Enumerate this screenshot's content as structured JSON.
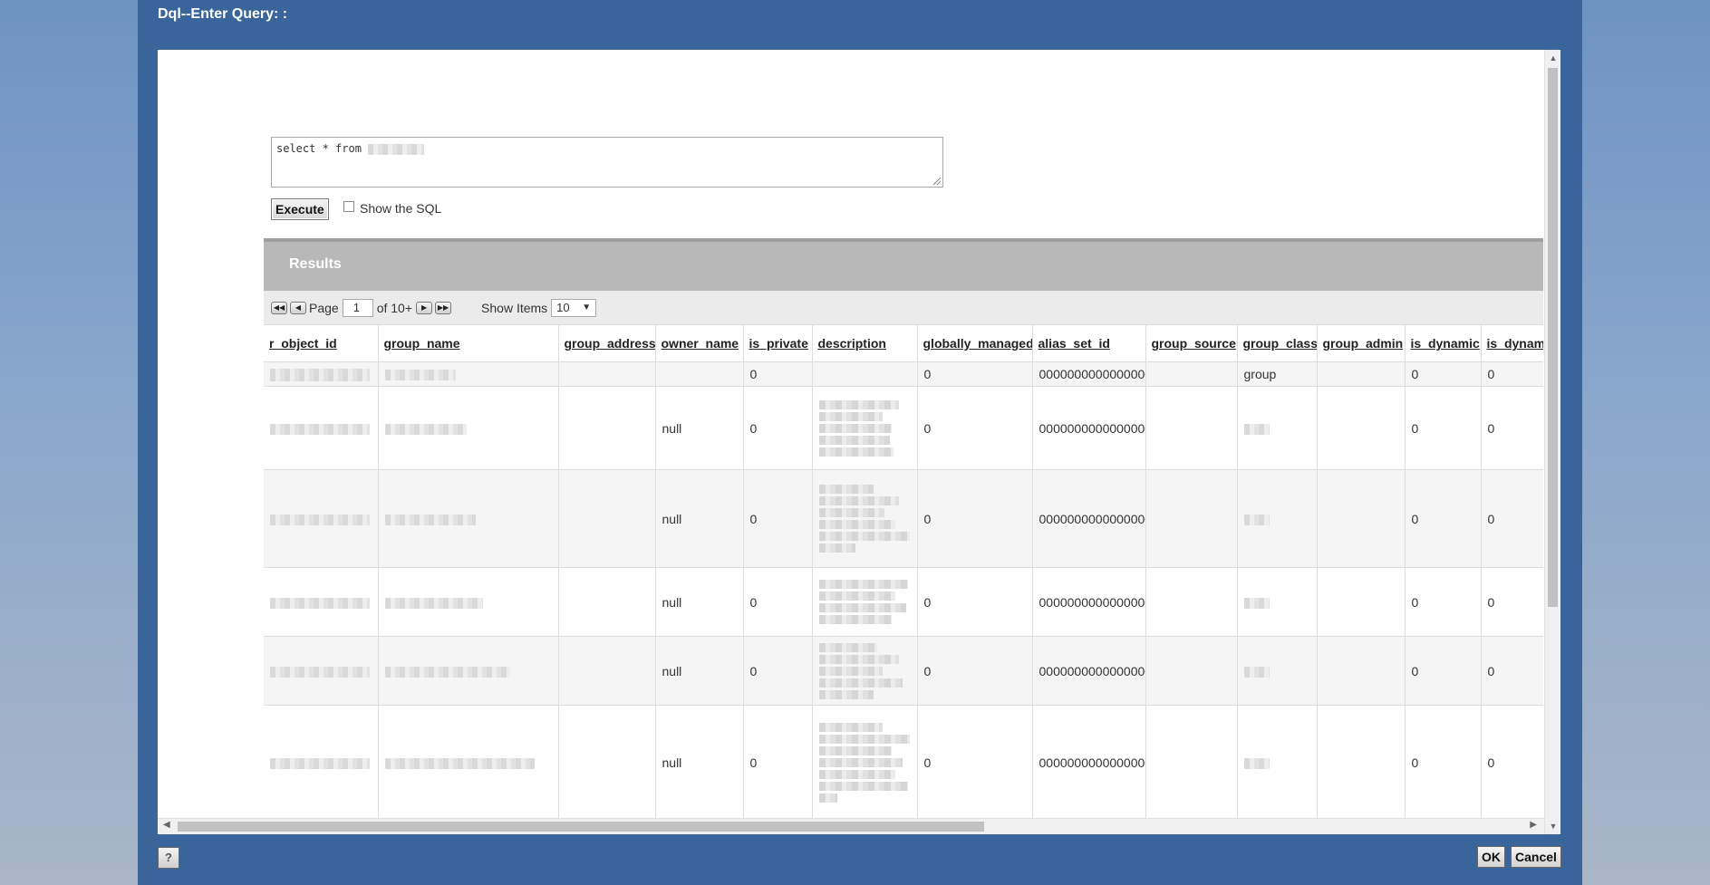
{
  "dialog": {
    "title": "Dql--Enter Query: :"
  },
  "query": {
    "text_prefix": "select * from"
  },
  "execute_label": "Execute",
  "show_sql_label": "Show the SQL",
  "results": {
    "title": "Results",
    "pager": {
      "page_label": "Page",
      "page_value": "1",
      "of_label": "of 10+",
      "show_items_label": "Show Items",
      "show_items_value": "10"
    },
    "columns": [
      "r_object_id",
      "group_name",
      "group_address",
      "owner_name",
      "is_private",
      "description",
      "globally_managed",
      "alias_set_id",
      "group_source",
      "group_class",
      "group_admin",
      "is_dynamic",
      "is_dynam"
    ],
    "rows": [
      {
        "owner_name": "",
        "is_private": "0",
        "globally_managed": "0",
        "alias_set_id": "0000000000000000",
        "group_class": "group",
        "is_dynamic": "0",
        "is_dynam": "0"
      },
      {
        "owner_name": "null",
        "is_private": "0",
        "globally_managed": "0",
        "alias_set_id": "0000000000000000",
        "group_class": "",
        "is_dynamic": "0",
        "is_dynam": "0"
      },
      {
        "owner_name": "null",
        "is_private": "0",
        "globally_managed": "0",
        "alias_set_id": "0000000000000000",
        "group_class": "",
        "is_dynamic": "0",
        "is_dynam": "0"
      },
      {
        "owner_name": "null",
        "is_private": "0",
        "globally_managed": "0",
        "alias_set_id": "0000000000000000",
        "group_class": "",
        "is_dynamic": "0",
        "is_dynam": "0"
      },
      {
        "owner_name": "null",
        "is_private": "0",
        "globally_managed": "0",
        "alias_set_id": "0000000000000000",
        "group_class": "",
        "is_dynamic": "0",
        "is_dynam": "0"
      },
      {
        "owner_name": "null",
        "is_private": "0",
        "globally_managed": "0",
        "alias_set_id": "0000000000000000",
        "group_class": "",
        "is_dynamic": "0",
        "is_dynam": "0"
      }
    ]
  },
  "footer": {
    "help_label": "?",
    "ok_label": "OK",
    "cancel_label": "Cancel"
  }
}
